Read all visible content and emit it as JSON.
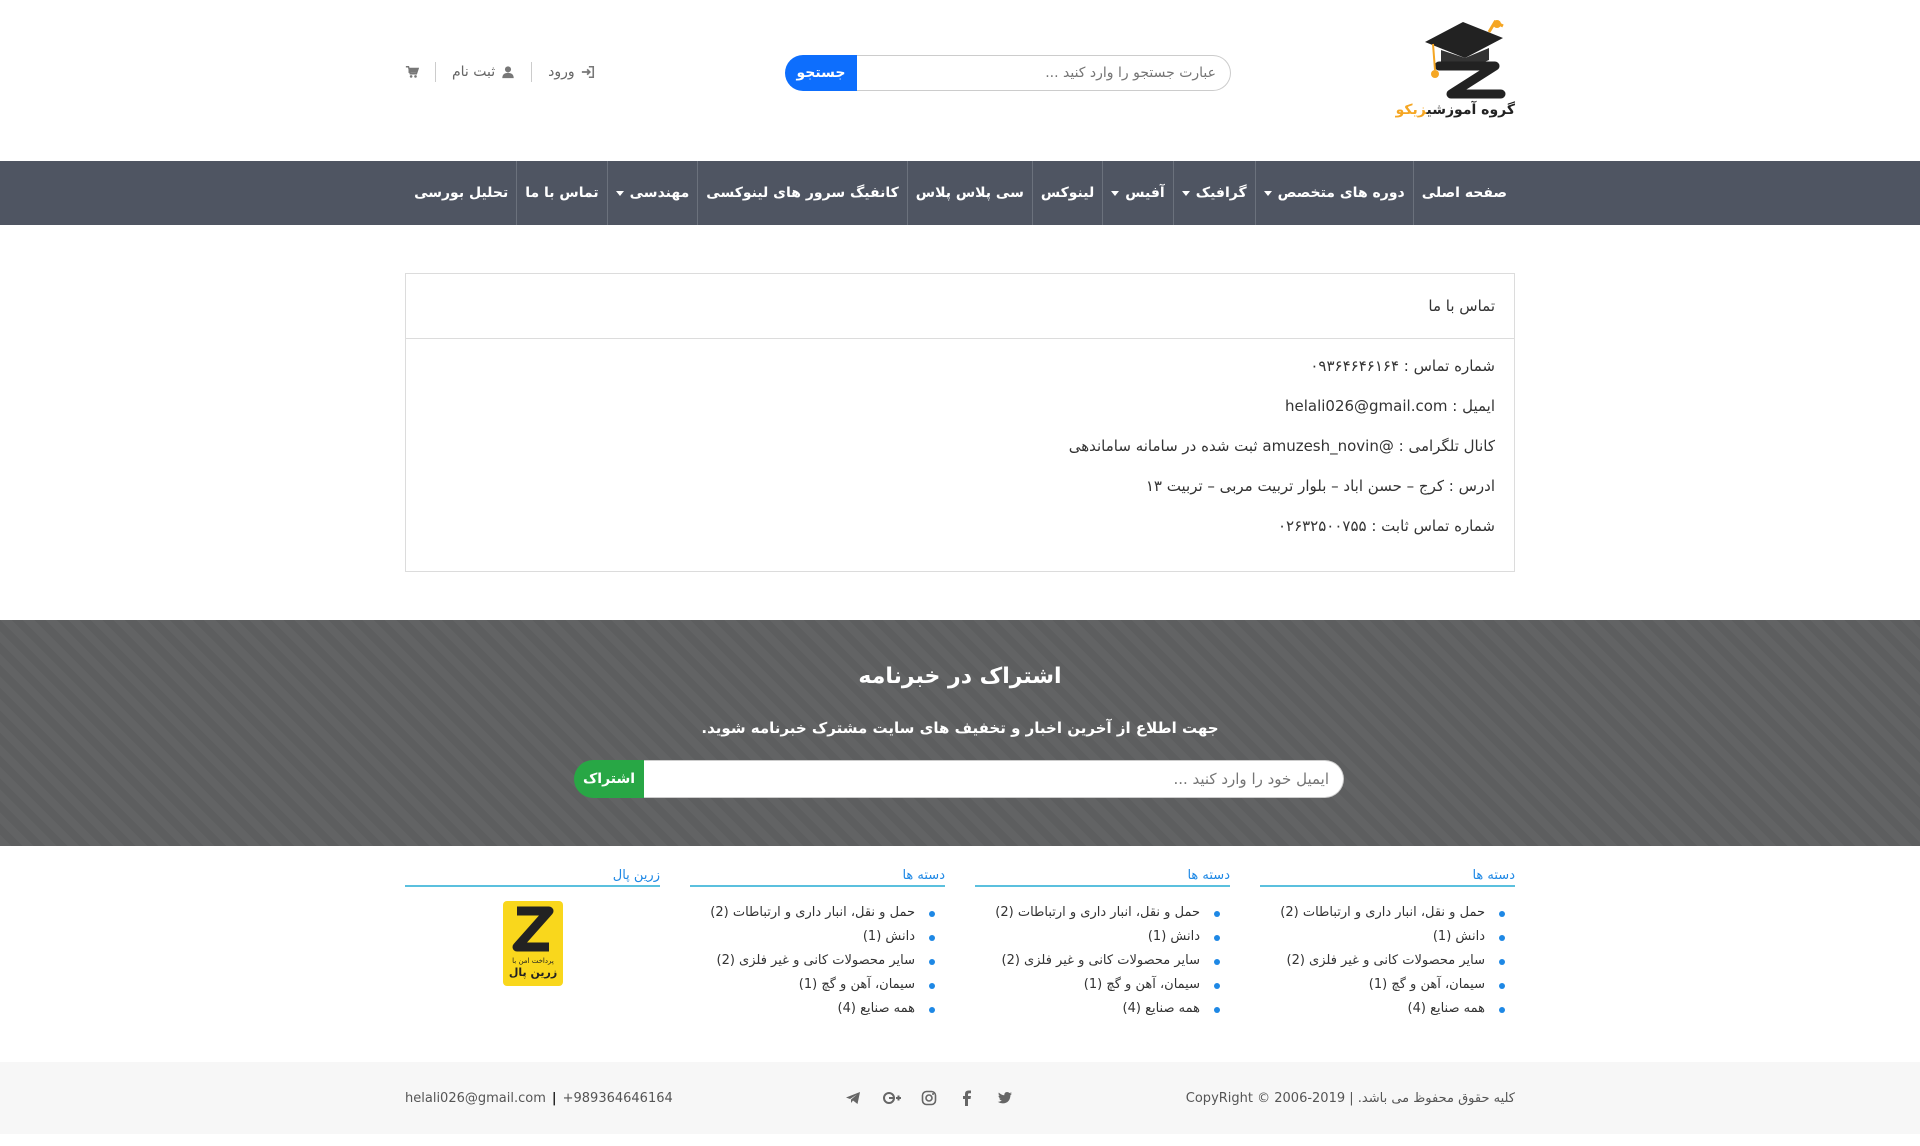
{
  "brand": {
    "name_prefix": "گروه آموزشی",
    "name_accent": "زیکو",
    "accent_color": "#f5a623"
  },
  "header": {
    "search_placeholder": "عبارت جستجو را وارد کنید ...",
    "search_button": "جستجو",
    "login": "ورود",
    "register": "ثبت نام",
    "icons": [
      "sign-in-icon",
      "user-icon",
      "cart-icon"
    ]
  },
  "nav": {
    "items": [
      {
        "label": "صفحه اصلی",
        "dropdown": false
      },
      {
        "label": "دوره های متخصص",
        "dropdown": true
      },
      {
        "label": "گرافیک",
        "dropdown": true
      },
      {
        "label": "آفیس",
        "dropdown": true
      },
      {
        "label": "لینوکس",
        "dropdown": false
      },
      {
        "label": "سی پلاس پلاس",
        "dropdown": false
      },
      {
        "label": "کانفیگ سرور های لینوکسی",
        "dropdown": false
      },
      {
        "label": "مهندسی",
        "dropdown": true
      },
      {
        "label": "تماس با ما",
        "dropdown": false
      },
      {
        "label": "تحلیل بورسی",
        "dropdown": false
      }
    ],
    "background": "#4f5562"
  },
  "contact": {
    "title": "تماس با ما",
    "lines": [
      "شماره تماس : ۰۹۳۶۴۶۴۶۱۶۴",
      "ایمیل : helali026@gmail.com",
      "کانال تلگرامی : @amuzesh_novin ثبت شده در سامانه ساماندهی",
      "ادرس : کرج – حسن اباد – بلوار تربیت مربی – تربیت ۱۳",
      "شماره تماس ثابت : ۰۲۶۳۲۵۰۰۷۵۵"
    ]
  },
  "newsletter": {
    "title": "اشتراک در خبرنامه",
    "subtitle": "جهت اطلاع از آخرین اخبار و تخفیف های سایت مشترک خبرنامه شوید.",
    "email_placeholder": "ایمیل خود را وارد کنید ...",
    "button": "اشتراک",
    "button_color": "#28a745"
  },
  "footer_widgets": {
    "categories_title": "دسته ها",
    "categories": [
      "حمل و نقل، انبار داری و ارتباطات (2)",
      "دانش (1)",
      "سایر محصولات کانی و غیر فلزی (2)",
      "سیمان، آهن و گچ (1)",
      "همه صنایع (4)"
    ],
    "zarinpal_title": "زرین پال",
    "zarinpal_caption": "پرداخت امن با",
    "zarinpal_brand": "زرین پال"
  },
  "bottom_bar": {
    "copyright": "کلیه حقوق محفوظ می باشد. | CopyRight © 2006-2019",
    "phone": "+989364646164",
    "separator": "|",
    "email": "helali026@gmail.com",
    "social_icons": [
      "telegram-icon",
      "google-plus-icon",
      "instagram-icon",
      "facebook-icon",
      "twitter-icon"
    ]
  }
}
